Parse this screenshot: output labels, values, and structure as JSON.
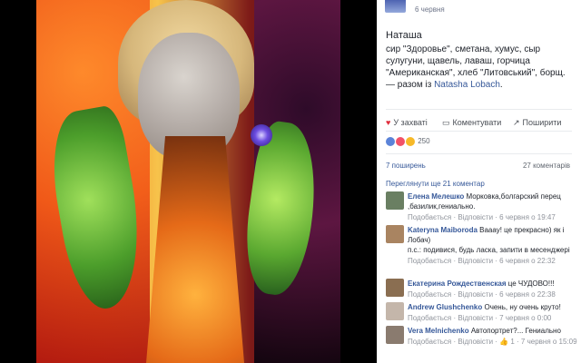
{
  "photo": {
    "alt": ""
  },
  "post": {
    "time": "6 червня",
    "title": "Наташа",
    "description_main": "сир \"Здоровье\", сметана, хумус, сыр сулугуни, щавель, лаваш, горчица \"Американская\", хлеб \"Литовський\", борщ.",
    "description_suffix": " — разом із ",
    "tagged_name": "Natasha Lobach",
    "description_end": "."
  },
  "actions": {
    "like": "У захваті",
    "comment": "Коментувати",
    "share": "Поширити"
  },
  "reactions": {
    "count": "250"
  },
  "stats": {
    "shares": "7 поширень",
    "comments": "27 коментарів",
    "more_comments": "Переглянути ще 21 коментар"
  },
  "comments": [
    {
      "name": "Елена Мелешко",
      "text": "Морковка,болгарский перец ,базилик,гениально.",
      "meta": "Подобається · Відповісти · 6 червня о 19:47"
    },
    {
      "name": "Kateryna Maiboroda",
      "text": "Вааау! це прекрасно) як і Лобач)",
      "text2": "п.с.: подивися, будь ласка, запити в месенджері",
      "meta": "Подобається · Відповісти · 6 червня о 22:32"
    },
    {
      "name": "Екатерина Рождественская",
      "text": "це ЧУДОВО!!!",
      "meta": "Подобається · Відповісти · 6 червня о 22:38"
    },
    {
      "name": "Andrew Glushchenko",
      "text": "Очень, ну очень круто!",
      "meta": "Подобається · Відповісти · 7 червня о 0:00"
    },
    {
      "name": "Vera Melnichenko",
      "text": "Автопортрет?... Гениально",
      "meta": "Подобається · Відповісти · 👍 1 · 7 червня о 15:09"
    }
  ],
  "colors": {
    "link": "#365899",
    "muted": "#90949c",
    "like": "#e02d3c"
  }
}
